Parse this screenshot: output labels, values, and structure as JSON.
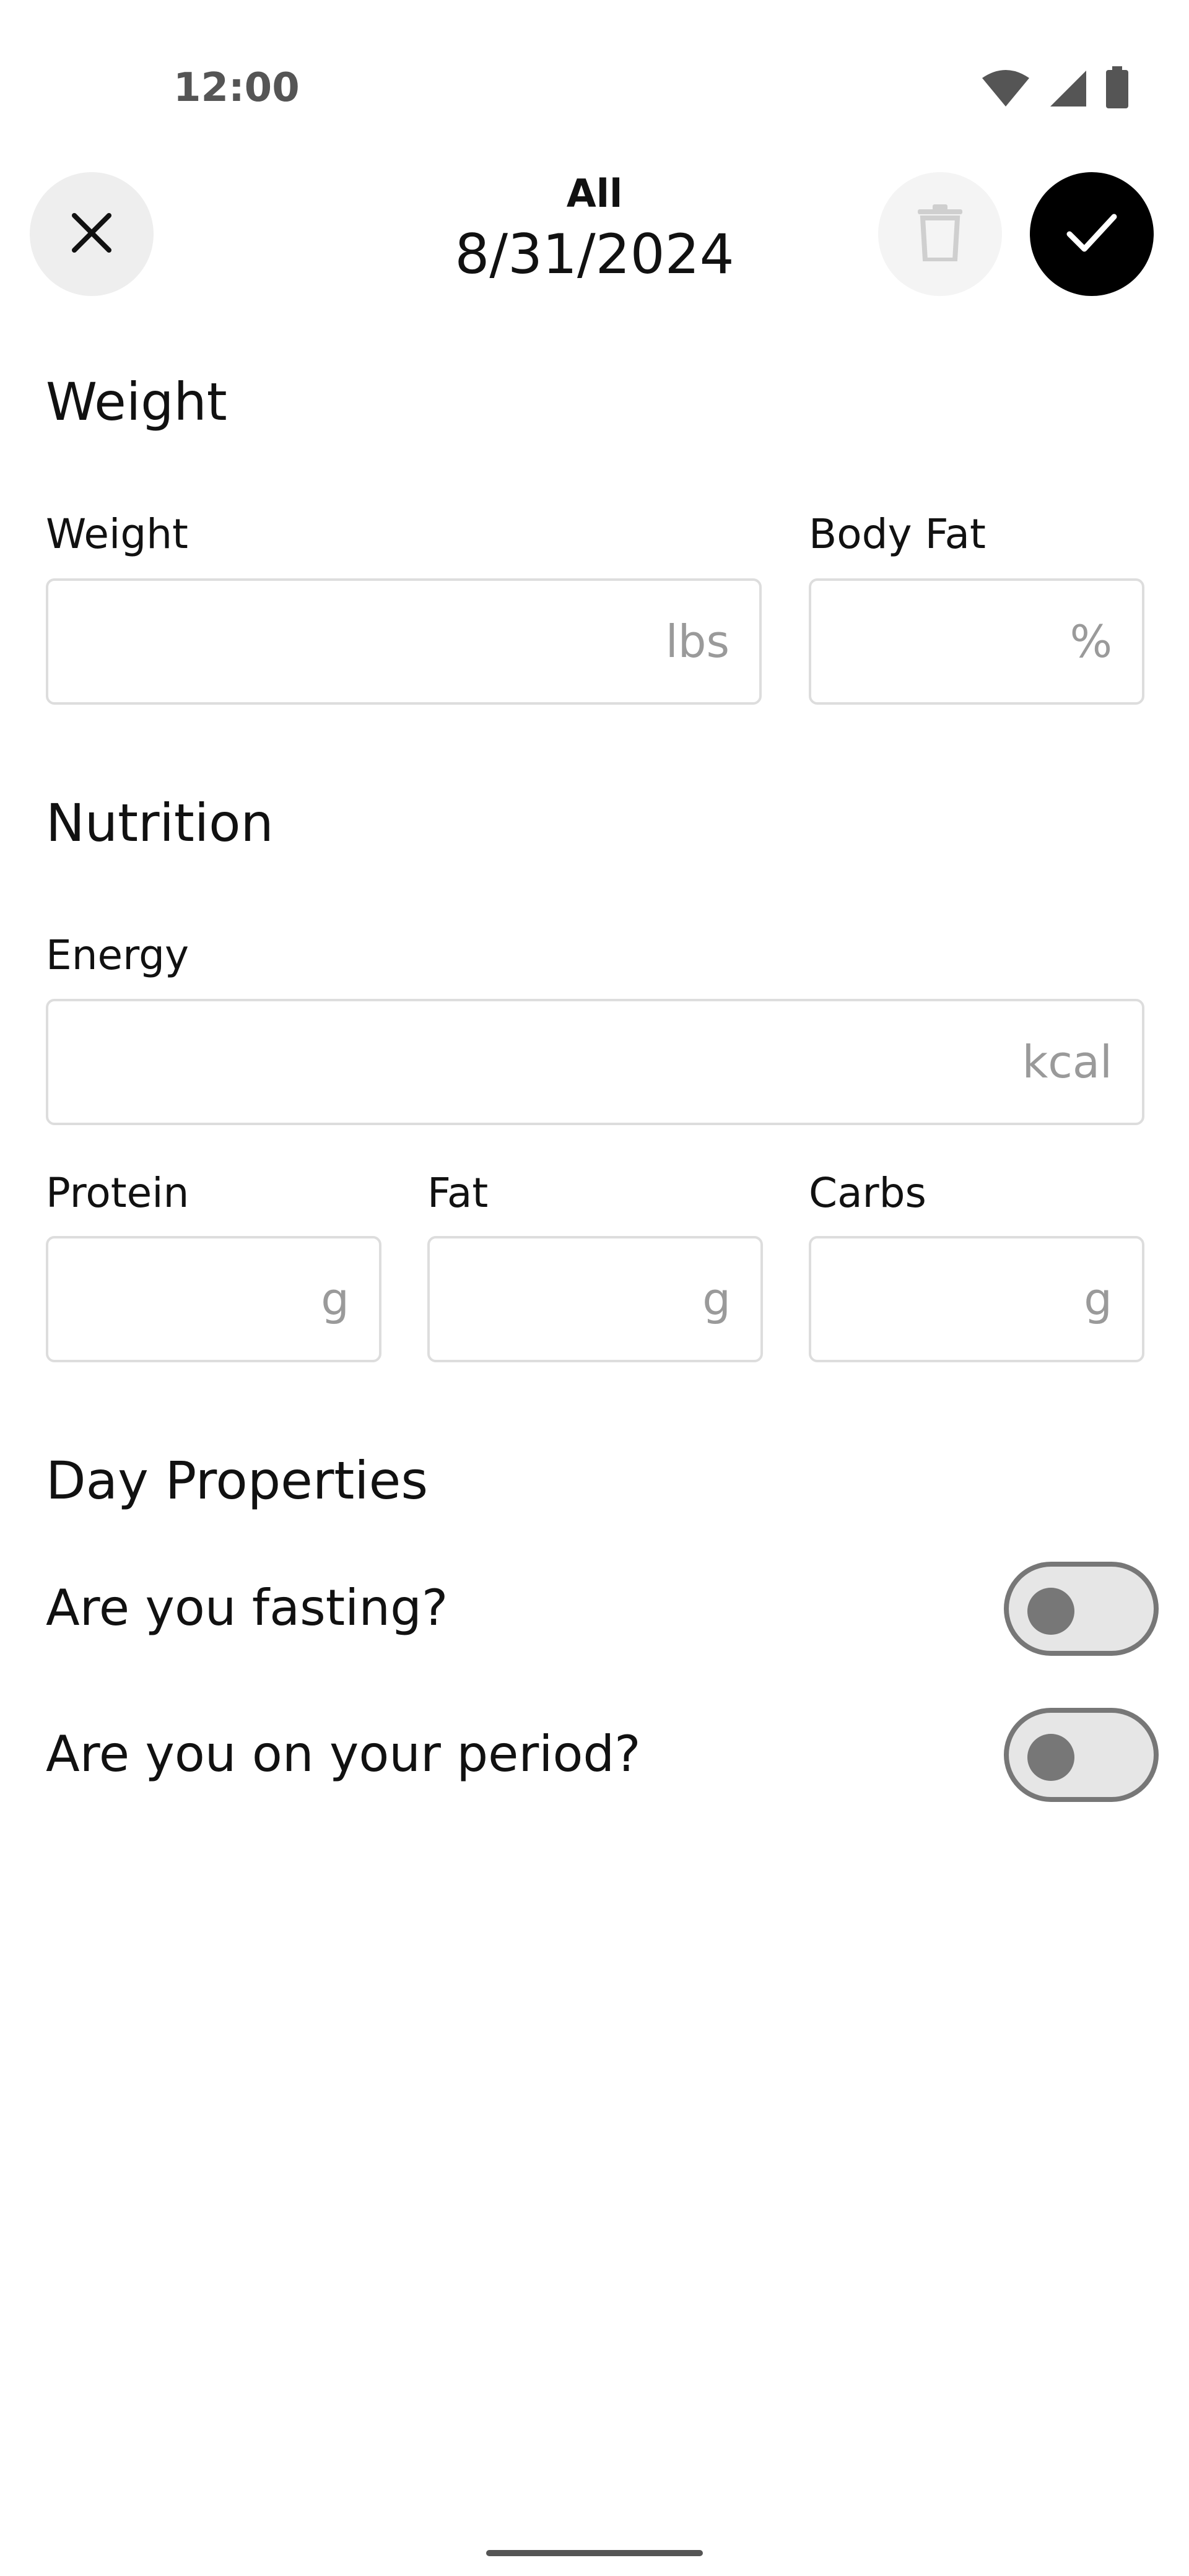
{
  "status_bar": {
    "time": "12:00",
    "icons": [
      "wifi-icon",
      "signal-icon",
      "battery-icon"
    ]
  },
  "header": {
    "title": "All",
    "date": "8/31/2024",
    "close_icon": "close-icon",
    "delete_icon": "trash-icon",
    "save_icon": "check-icon"
  },
  "weight_section": {
    "title": "Weight",
    "weight": {
      "label": "Weight",
      "unit": "lbs",
      "value": ""
    },
    "body_fat": {
      "label": "Body Fat",
      "unit": "%",
      "value": ""
    }
  },
  "nutrition_section": {
    "title": "Nutrition",
    "energy": {
      "label": "Energy",
      "unit": "kcal",
      "value": ""
    },
    "protein": {
      "label": "Protein",
      "unit": "g",
      "value": ""
    },
    "fat": {
      "label": "Fat",
      "unit": "g",
      "value": ""
    },
    "carbs": {
      "label": "Carbs",
      "unit": "g",
      "value": ""
    }
  },
  "day_properties": {
    "title": "Day Properties",
    "fasting": {
      "label": "Are you fasting?",
      "on": false
    },
    "period": {
      "label": "Are you on your period?",
      "on": false
    }
  },
  "colors": {
    "save_button": "#000000",
    "close_button": "#eeeeee",
    "field_border": "#dddddd",
    "unit_text": "#9a9a9a",
    "toggle_track": "#e6e6e6",
    "toggle_border": "#777777"
  }
}
